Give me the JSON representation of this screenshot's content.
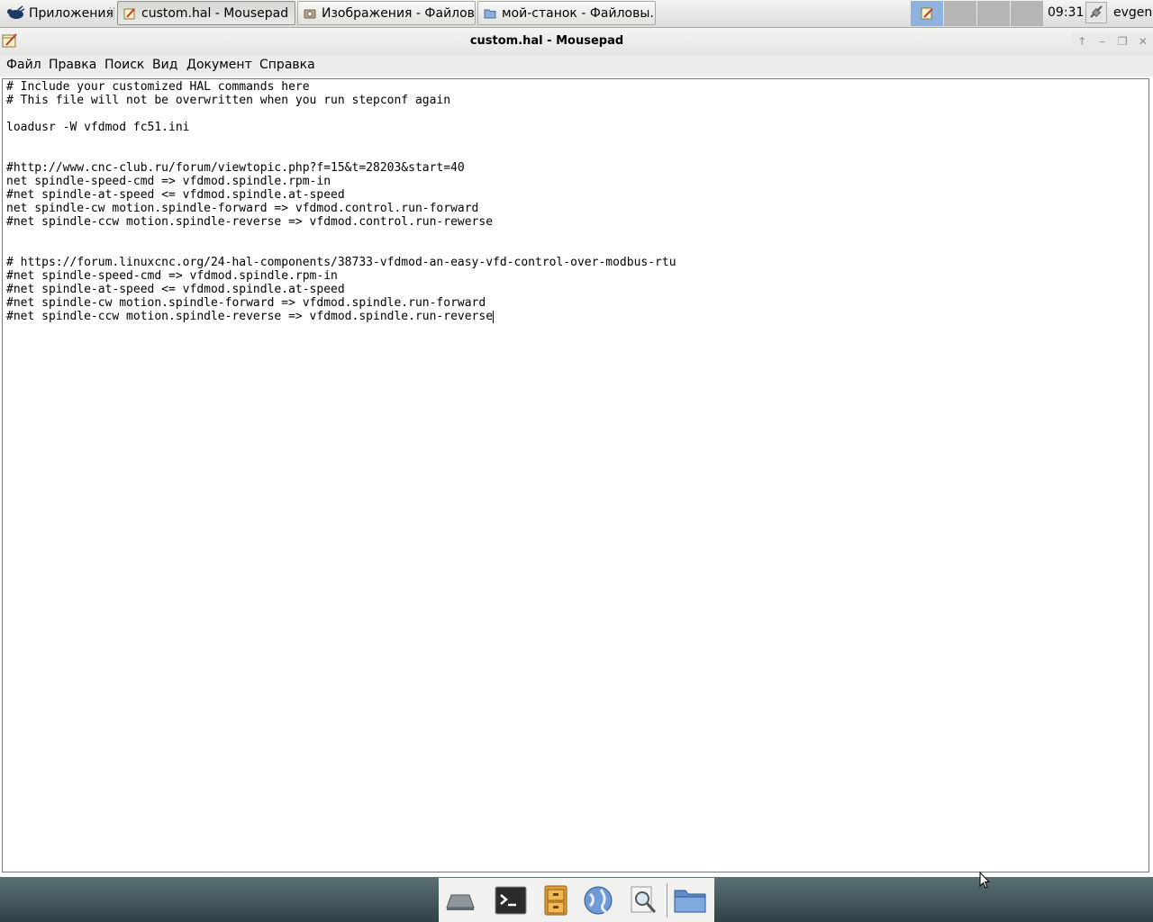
{
  "top_panel": {
    "apps_label": "Приложения",
    "tasks": [
      {
        "label": "custom.hal - Mousepad",
        "icon": "text-editor-icon"
      },
      {
        "label": "Изображения - Файлов...",
        "icon": "camera-folder-icon"
      },
      {
        "label": "мой-станок - Файловы...",
        "icon": "folder-icon"
      }
    ],
    "clock": "09:31",
    "user": "evgen"
  },
  "window": {
    "title": "custom.hal - Mousepad"
  },
  "menu": [
    "Файл",
    "Правка",
    "Поиск",
    "Вид",
    "Документ",
    "Справка"
  ],
  "editor": {
    "lines": [
      "# Include your customized HAL commands here",
      "# This file will not be overwritten when you run stepconf again",
      "",
      "loadusr -W vfdmod fc51.ini",
      "",
      "",
      "#http://www.cnc-club.ru/forum/viewtopic.php?f=15&t=28203&start=40",
      "net spindle-speed-cmd => vfdmod.spindle.rpm-in",
      "#net spindle-at-speed <= vfdmod.spindle.at-speed",
      "net spindle-cw motion.spindle-forward => vfdmod.control.run-forward",
      "#net spindle-ccw motion.spindle-reverse => vfdmod.control.run-rewerse",
      "",
      "",
      "# https://forum.linuxcnc.org/24-hal-components/38733-vfdmod-an-easy-vfd-control-over-modbus-rtu",
      "#net spindle-speed-cmd => vfdmod.spindle.rpm-in",
      "#net spindle-at-speed <= vfdmod.spindle.at-speed",
      "#net spindle-cw motion.spindle-forward => vfdmod.spindle.run-forward",
      "#net spindle-ccw motion.spindle-reverse => vfdmod.spindle.run-reverse"
    ]
  },
  "dock": {
    "launchers": [
      "show-desktop-icon",
      "terminal-icon",
      "file-cabinet-icon",
      "web-browser-icon",
      "search-icon",
      "folder-icon"
    ]
  },
  "colors": {
    "workspace_active": "#8fb2de",
    "bottom_panel": "#3e5357"
  }
}
